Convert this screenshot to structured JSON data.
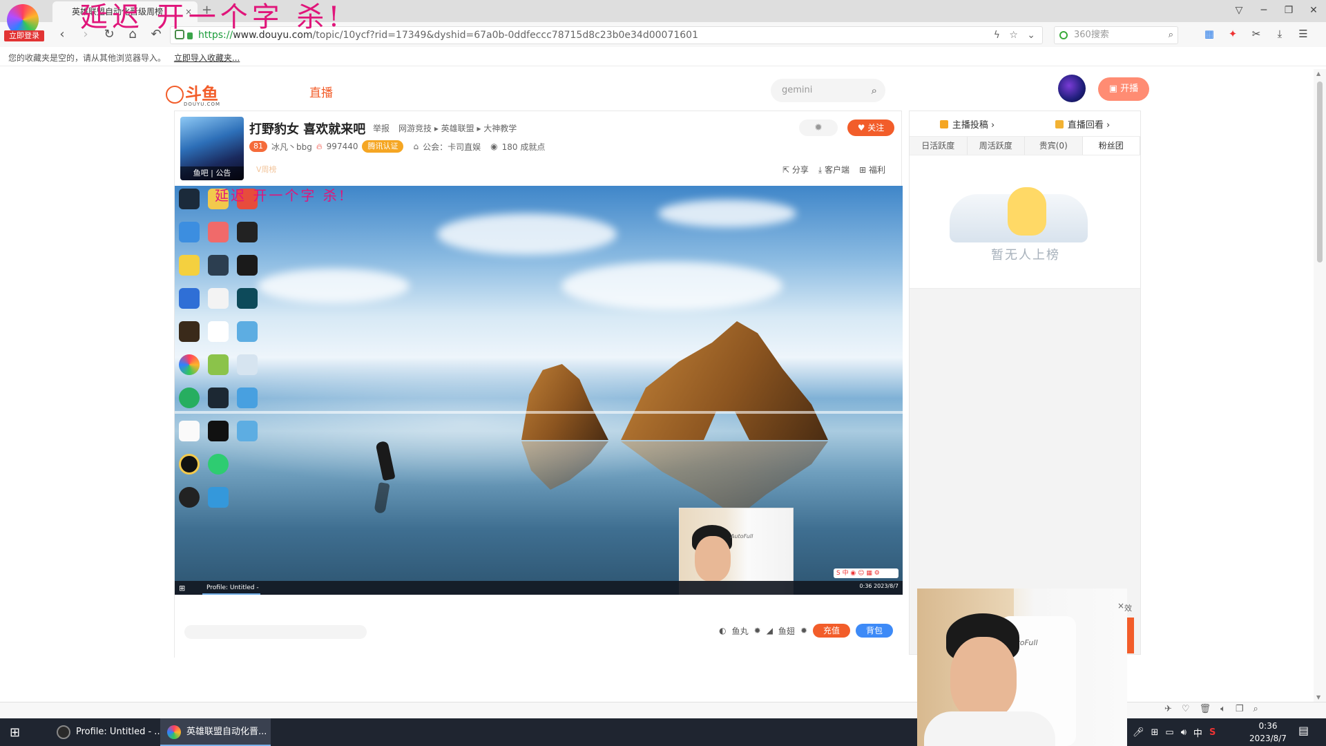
{
  "overlay_text": "延迟 开一个字 杀!",
  "browser": {
    "login_badge": "立即登录",
    "tab_title": "英雄联盟自动化晋级周榜",
    "tab_close": "×",
    "new_tab": "+",
    "url_prefix": "https://",
    "url_host": "www.douyu.com",
    "url_path": "/topic/10ycf?rid=17349&dyshid=67a0b-0ddfeccc78715d8c23b0e34d00071601",
    "search_placeholder": "360搜索",
    "favbar_text": "您的收藏夹是空的，请从其他浏览器导入。",
    "favbar_link": "立即导入收藏夹..."
  },
  "site": {
    "logo_text": "斗鱼",
    "logo_sub": "DOUYU.COM",
    "nav_live": "直播",
    "search_placeholder": "gemini",
    "kaibo_label": "开播"
  },
  "room": {
    "avatar_label": "鱼吧 | 公告",
    "title": "打野豹女 喜欢就来吧",
    "report": "举报",
    "category": "网游竞技 ▸ 英雄联盟 ▸ 大神教学",
    "level": "81",
    "streamer_name": "冰凡丶bbg",
    "hot_value": "997440",
    "cert": "腾讯认证",
    "guild": "公会：卡司直娱",
    "achievements": "180 成就点",
    "vip": "V周榜",
    "follow": "关注",
    "share": "分享",
    "client": "客户端",
    "welfare": "福利"
  },
  "video": {
    "overlay_text": "延迟 开一个字 杀!",
    "taskbar_app": "Profile: Untitled - ...",
    "tray_time": "0:36",
    "tray_date": "2023/8/7",
    "webcam_brand": "AutoFull"
  },
  "gift": {
    "yuwan": "鱼丸",
    "yuchi": "鱼翅",
    "recharge": "充值",
    "bag": "背包"
  },
  "right_panel": {
    "link1": "主播投稿",
    "link2": "直播回看",
    "tabs": [
      "日活跃度",
      "周活跃度",
      "贵宾(0)",
      "粉丝团"
    ],
    "empty_text": "暂无人上榜"
  },
  "float_cam": {
    "brand": "AutoFull",
    "close": "×",
    "side": "效"
  },
  "taskbar": {
    "item1": "Profile: Untitled - ...",
    "item2": "英雄联盟自动化晋...",
    "ime": "中",
    "time": "0:36",
    "date": "2023/8/7"
  },
  "colors": {
    "brand_orange": "#f25d2a",
    "overlay_magenta": "#e0157a",
    "bag_blue": "#3d8af7"
  }
}
